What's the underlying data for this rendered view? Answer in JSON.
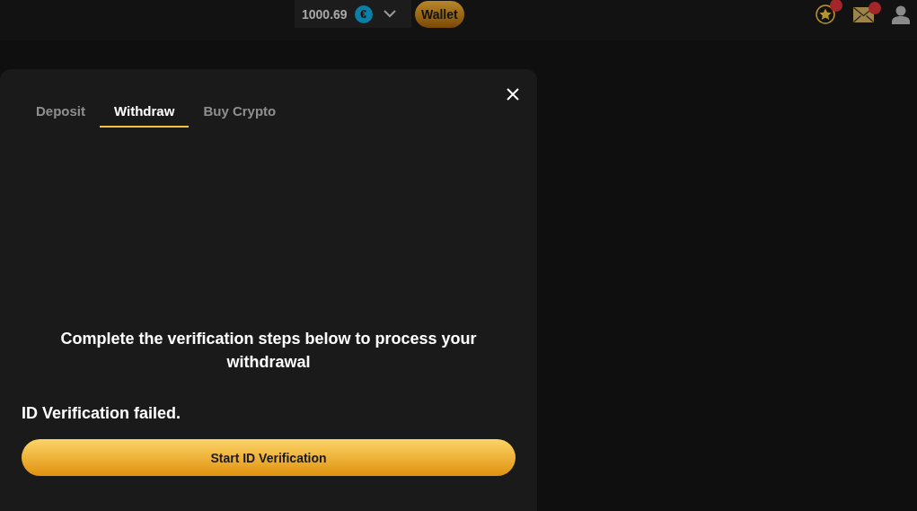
{
  "header": {
    "balance": "1000.69",
    "currency_symbol": "€",
    "wallet_button": "Wallet",
    "notifications": [
      {
        "kind": "star",
        "badge": true
      },
      {
        "kind": "mail",
        "badge": true
      },
      {
        "kind": "user",
        "badge": false
      }
    ]
  },
  "modal": {
    "tabs": [
      {
        "label": "Deposit",
        "selected": false
      },
      {
        "label": "Withdraw",
        "selected": true
      },
      {
        "label": "Buy Crypto",
        "selected": false
      }
    ],
    "message": "Complete the verification steps below to process your withdrawal",
    "status": "ID Verification failed.",
    "button": "Start ID Verification"
  }
}
